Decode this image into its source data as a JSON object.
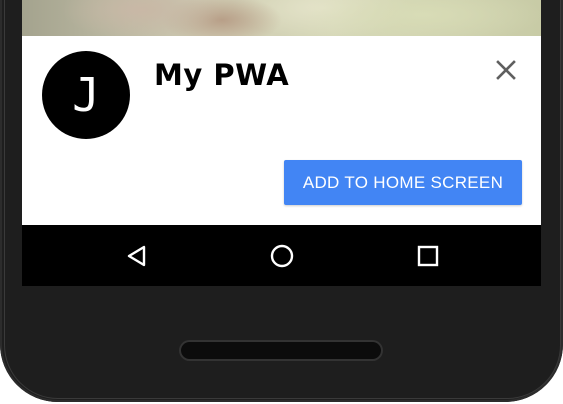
{
  "banner": {
    "app_icon_letter": "J",
    "app_name": "My PWA",
    "add_button_label": "ADD TO HOME SCREEN",
    "accent_color": "#4285f4"
  },
  "icons": {
    "close": "close-icon",
    "back": "back-triangle-icon",
    "home": "home-circle-icon",
    "recents": "recents-square-icon"
  }
}
